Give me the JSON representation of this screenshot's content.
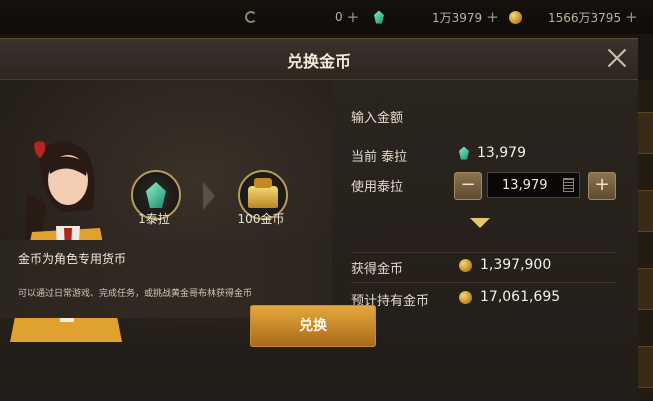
{
  "topbar": {
    "currency_c": "0",
    "currency_taila": "1万3979",
    "currency_gold": "1566万3795"
  },
  "dialog": {
    "title": "兑换金币",
    "exchange_from_label": "1泰拉",
    "exchange_to_label": "100金币",
    "info_title": "金币为角色专用货币",
    "info_desc": "可以通过日常游戏、完成任务，或挑战黄金哥布林获得金币",
    "form": {
      "section_title": "输入金额",
      "current_label": "当前 泰拉",
      "current_value": "13,979",
      "use_label": "使用泰拉",
      "use_value": "13,979",
      "gain_label": "获得金币",
      "gain_value": "1,397,900",
      "expected_label": "预计持有金币",
      "expected_value": "17,061,695"
    },
    "exchange_button": "兑换"
  },
  "colors": {
    "accent_gold": "#e7a93b",
    "gem_green": "#1f8f6e",
    "background": "#2b2620"
  },
  "icons": [
    "c-currency-icon",
    "taila-gem-icon",
    "gold-coin-icon",
    "plus-icon",
    "close-icon",
    "calculator-icon",
    "chevron-down-icon",
    "arrow-right-icon"
  ]
}
